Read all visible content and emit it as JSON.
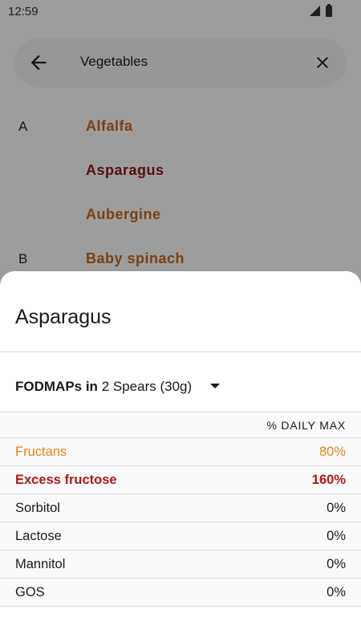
{
  "status_bar": {
    "time": "12:59"
  },
  "search": {
    "query": "Vegetables"
  },
  "list": {
    "rows": [
      {
        "letter": "A",
        "name": "Alfalfa",
        "color": "#c0641c"
      },
      {
        "letter": "",
        "name": "Asparagus",
        "color": "#8a1616"
      },
      {
        "letter": "",
        "name": "Aubergine",
        "color": "#c0641c"
      },
      {
        "letter": "B",
        "name": "Baby spinach",
        "color": "#c0641c"
      }
    ]
  },
  "sheet": {
    "title": "Asparagus",
    "serving_label": "FODMAPs in",
    "serving_value": "2 Spears (30g)",
    "column_header": "% DAILY MAX",
    "rows": [
      {
        "name": "Fructans",
        "value": "80%",
        "color": "#e8801e",
        "bold": false
      },
      {
        "name": "Excess fructose",
        "value": "160%",
        "color": "#b01818",
        "bold": true
      },
      {
        "name": "Sorbitol",
        "value": "0%",
        "color": "#1a1a1a",
        "bold": false
      },
      {
        "name": "Lactose",
        "value": "0%",
        "color": "#1a1a1a",
        "bold": false
      },
      {
        "name": "Mannitol",
        "value": "0%",
        "color": "#1a1a1a",
        "bold": false
      },
      {
        "name": "GOS",
        "value": "0%",
        "color": "#1a1a1a",
        "bold": false
      }
    ]
  }
}
